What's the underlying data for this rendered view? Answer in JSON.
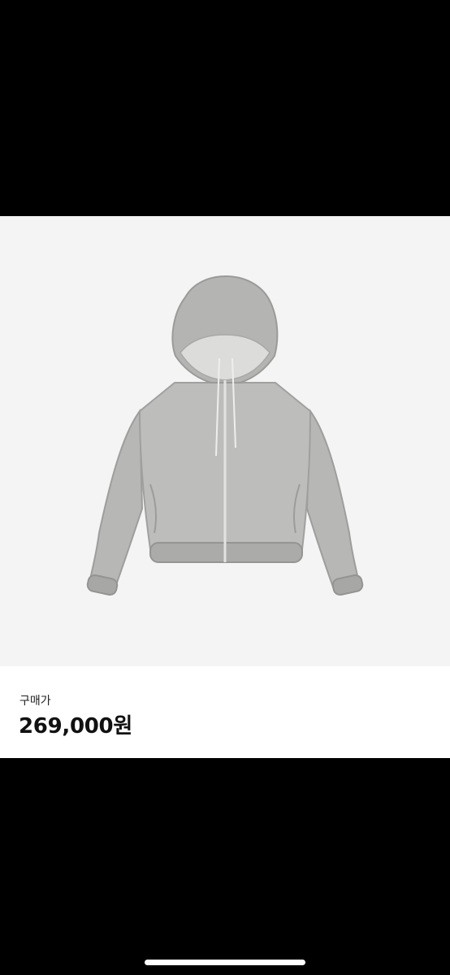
{
  "product": {
    "image_subject": "jacket",
    "background_color": "#f4f4f4",
    "garment_color": "#b3b3b3"
  },
  "price": {
    "label": "구매가",
    "value": "269,000원"
  },
  "colors": {
    "screen_background": "#000000",
    "panel_background": "#ffffff",
    "text_primary": "#111111",
    "home_indicator": "#ffffff"
  }
}
